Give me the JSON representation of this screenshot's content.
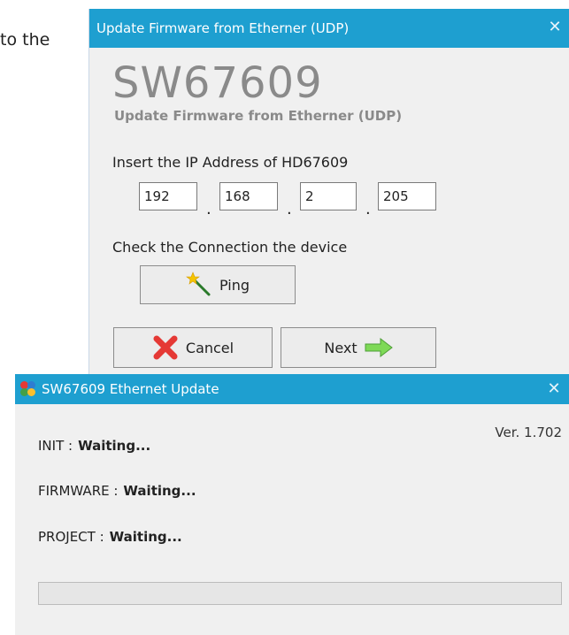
{
  "background_text": "to the",
  "wizard": {
    "title": "Update Firmware from Etherner (UDP)",
    "product": "SW67609",
    "subtitle": "Update Firmware from Etherner (UDP)",
    "ip_label": "Insert the IP Address of HD67609",
    "ip": [
      "192",
      "168",
      "2",
      "205"
    ],
    "ip_sep": ".",
    "check_label": "Check the Connection the device",
    "ping_label": "Ping",
    "cancel_label": "Cancel",
    "next_label": "Next",
    "close_symbol": "✕"
  },
  "updater": {
    "title": "SW67609 Ethernet Update",
    "version": "Ver. 1.702",
    "rows": [
      {
        "label": "INIT :",
        "value": "Waiting..."
      },
      {
        "label": "FIRMWARE :",
        "value": "Waiting..."
      },
      {
        "label": "PROJECT :",
        "value": "Waiting..."
      }
    ],
    "progress": 0,
    "close_symbol": "✕"
  },
  "colors": {
    "titlebar": "#1e9fd0",
    "cancel_x": "#e53935",
    "next_arrow": "#7ed957"
  },
  "icons": {
    "ping": "magic-wand-icon",
    "cancel": "red-x-icon",
    "next": "green-arrow-right-icon",
    "app": "app-logo-icon"
  }
}
